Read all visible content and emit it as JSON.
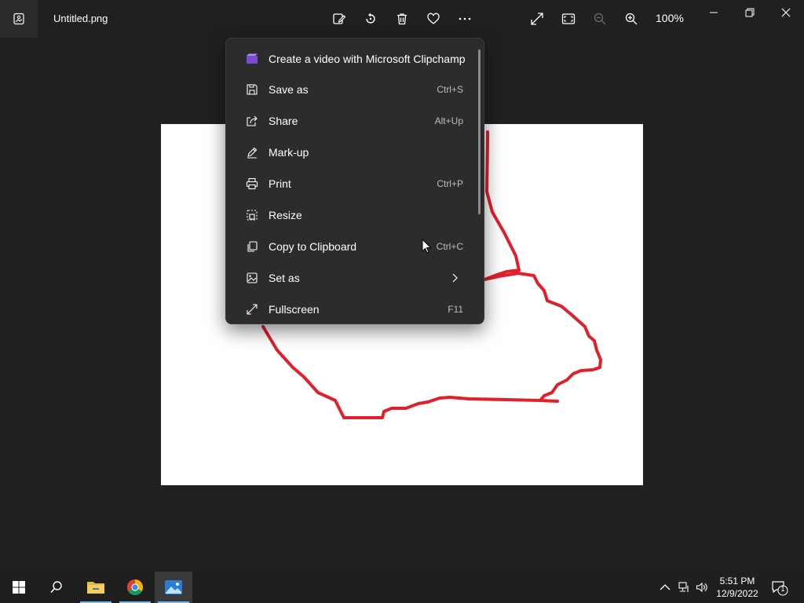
{
  "titlebar": {
    "file_name": "Untitled.png",
    "zoom_level": "100%"
  },
  "icons": {
    "app": "photos-app-icon",
    "edit": "edit-image-icon",
    "rotate": "rotate-icon",
    "delete": "delete-icon",
    "favorite": "heart-icon",
    "more": "more-icon",
    "fullscreen": "expand-icon",
    "fit": "fit-window-icon",
    "zoom_out": "zoom-out-icon",
    "zoom_in": "zoom-in-icon"
  },
  "menu": {
    "items": [
      {
        "label": "Create a video with Microsoft Clipchamp",
        "shortcut": "",
        "icon": "clipchamp-icon"
      },
      {
        "label": "Save as",
        "shortcut": "Ctrl+S",
        "icon": "save-icon"
      },
      {
        "label": "Share",
        "shortcut": "Alt+Up",
        "icon": "share-icon"
      },
      {
        "label": "Mark-up",
        "shortcut": "",
        "icon": "pen-icon"
      },
      {
        "label": "Print",
        "shortcut": "Ctrl+P",
        "icon": "print-icon"
      },
      {
        "label": "Resize",
        "shortcut": "",
        "icon": "resize-icon"
      },
      {
        "label": "Copy to Clipboard",
        "shortcut": "Ctrl+C",
        "icon": "copy-icon"
      },
      {
        "label": "Set as",
        "shortcut": "",
        "icon": "set-as-icon"
      },
      {
        "label": "Fullscreen",
        "shortcut": "F11",
        "icon": "fullscreen-icon"
      }
    ]
  },
  "taskbar": {
    "time": "5:51 PM",
    "date": "12/9/2022",
    "notification_count": "1"
  },
  "colors": {
    "background": "#202020",
    "menu_bg": "#2c2c2c",
    "drawing_stroke": "#e0202a",
    "accent": "#76b9ed"
  }
}
